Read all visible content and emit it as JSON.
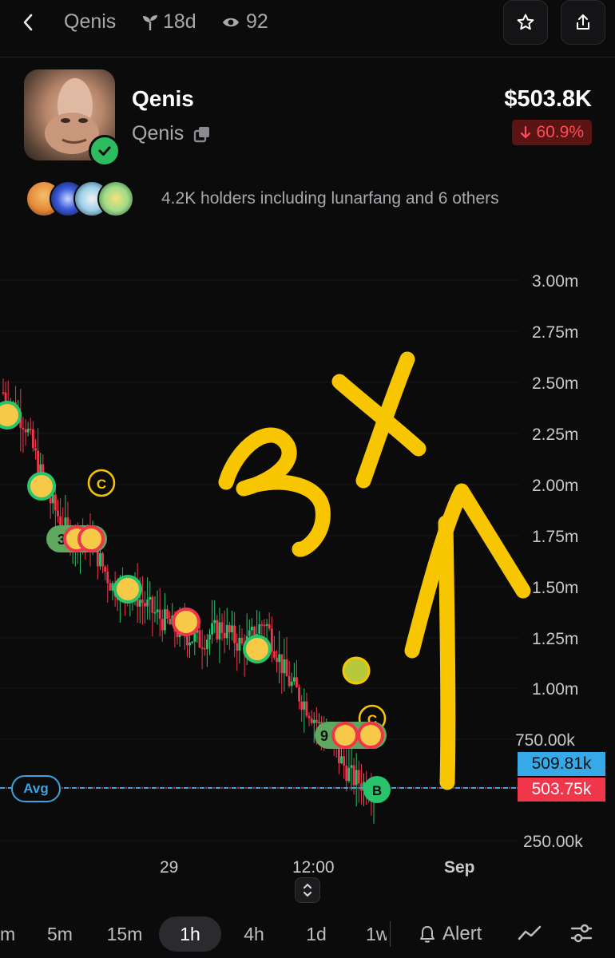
{
  "topbar": {
    "title": "Qenis",
    "age": "18d",
    "views": "92"
  },
  "token": {
    "name": "Qenis",
    "ticker": "Qenis",
    "market_cap": "$503.8K",
    "change": "60.9%",
    "holders_text": "4.2K holders including lunarfang and 6 others"
  },
  "chart": {
    "y_labels": [
      "3.00m",
      "2.75m",
      "2.50m",
      "2.25m",
      "2.00m",
      "1.75m",
      "1.50m",
      "1.25m",
      "1.00m",
      "750.00k",
      "250.00k"
    ],
    "x_labels": [
      "29",
      "12:00",
      "Sep"
    ],
    "price_tag_blue": "509.81k",
    "price_tag_red": "503.75k",
    "avg_label": "Avg",
    "marker_3": "3",
    "marker_9": "9",
    "marker_c": "C",
    "marker_b": "B",
    "colors": {
      "up": "#27c46b",
      "down": "#f0364a",
      "annotation": "#f7c600",
      "avg_line": "#3aa3e0"
    }
  },
  "chart_data": {
    "type": "candlestick",
    "ylim": [
      0.25,
      3.0
    ],
    "y_unit": "m",
    "approx_close_trend": [
      2.45,
      2.3,
      1.95,
      1.75,
      1.72,
      1.5,
      1.46,
      1.36,
      1.28,
      1.23,
      1.3,
      1.2,
      1.33,
      1.05,
      0.9,
      0.72,
      0.56,
      0.5
    ],
    "annotation_text": "3X"
  },
  "toolbar": {
    "timeframes": [
      "m",
      "5m",
      "15m",
      "1h",
      "4h",
      "1d",
      "1w"
    ],
    "active": "1h",
    "alert_label": "Alert"
  }
}
